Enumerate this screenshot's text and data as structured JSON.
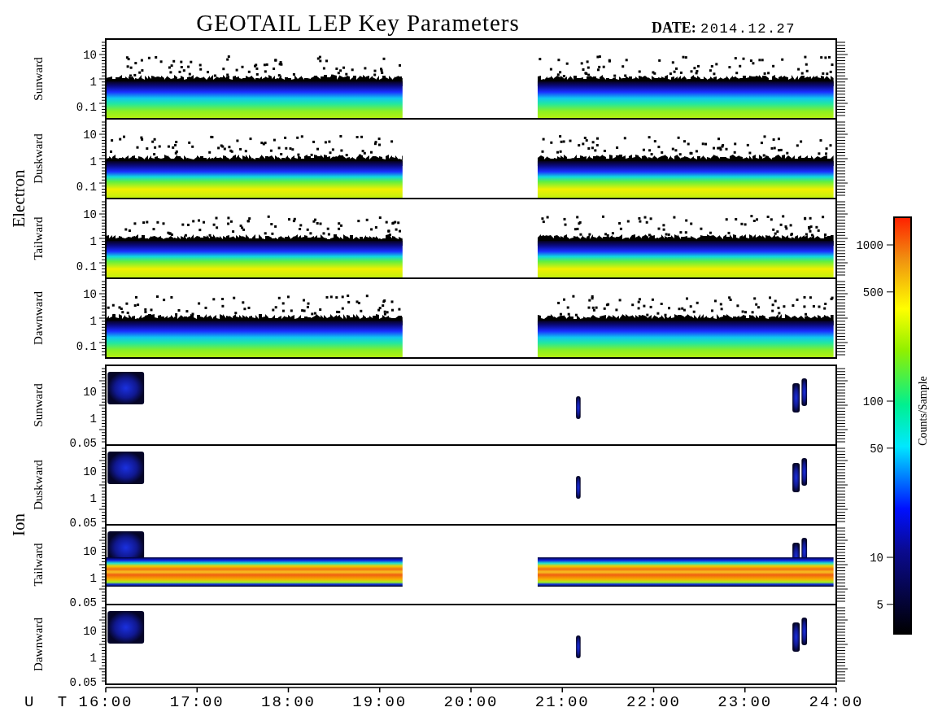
{
  "title": "GEOTAIL LEP Key Parameters",
  "date_label": "DATE:",
  "date": "2014.12.27",
  "groups": [
    {
      "label": "Electron",
      "panels": [
        {
          "label": "Sunward",
          "yticks": [
            "10",
            "1",
            "0.1"
          ]
        },
        {
          "label": "Duskward",
          "yticks": [
            "10",
            "1",
            "0.1"
          ]
        },
        {
          "label": "Tailward",
          "yticks": [
            "10",
            "1",
            "0.1"
          ]
        },
        {
          "label": "Dawnward",
          "yticks": [
            "10",
            "1",
            "0.1"
          ]
        }
      ]
    },
    {
      "label": "Ion",
      "panels": [
        {
          "label": "Sunward",
          "yticks": [
            "10",
            "1",
            "0.05"
          ]
        },
        {
          "label": "Duskward",
          "yticks": [
            "10",
            "1",
            "0.05"
          ]
        },
        {
          "label": "Tailward",
          "yticks": [
            "10",
            "1",
            "0.05"
          ]
        },
        {
          "label": "Dawnward",
          "yticks": [
            "10",
            "1",
            "0.05"
          ]
        }
      ]
    }
  ],
  "x_axis": {
    "label": "U T",
    "ticks": [
      "16:00",
      "17:00",
      "18:00",
      "19:00",
      "20:00",
      "21:00",
      "22:00",
      "23:00",
      "24:00"
    ]
  },
  "colorbar": {
    "label": "Counts/Sample",
    "ticks": [
      "1000",
      "500",
      "100",
      "50",
      "10",
      "5"
    ]
  }
}
